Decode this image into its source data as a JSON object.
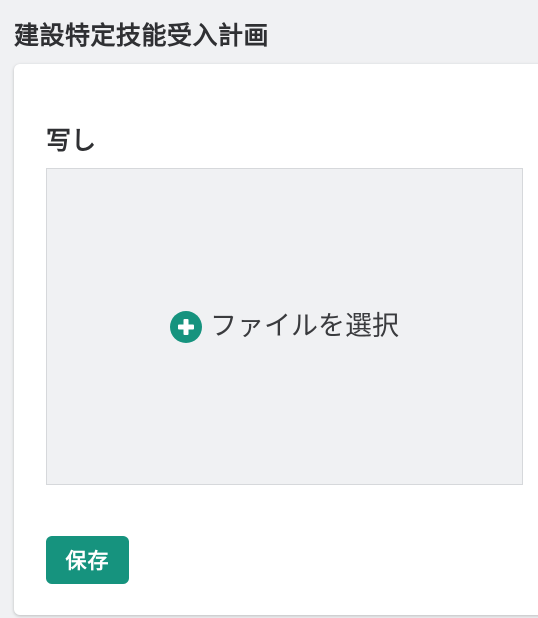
{
  "page": {
    "title": "建設特定技能受入計画"
  },
  "form": {
    "photo_label": "写し",
    "dropzone": {
      "icon": "plus-circle-icon",
      "label": "ファイルを選択"
    },
    "save_label": "保存"
  },
  "colors": {
    "accent": "#16937e",
    "background": "#f0f1f3",
    "card": "#ffffff",
    "text": "#2f3033"
  }
}
